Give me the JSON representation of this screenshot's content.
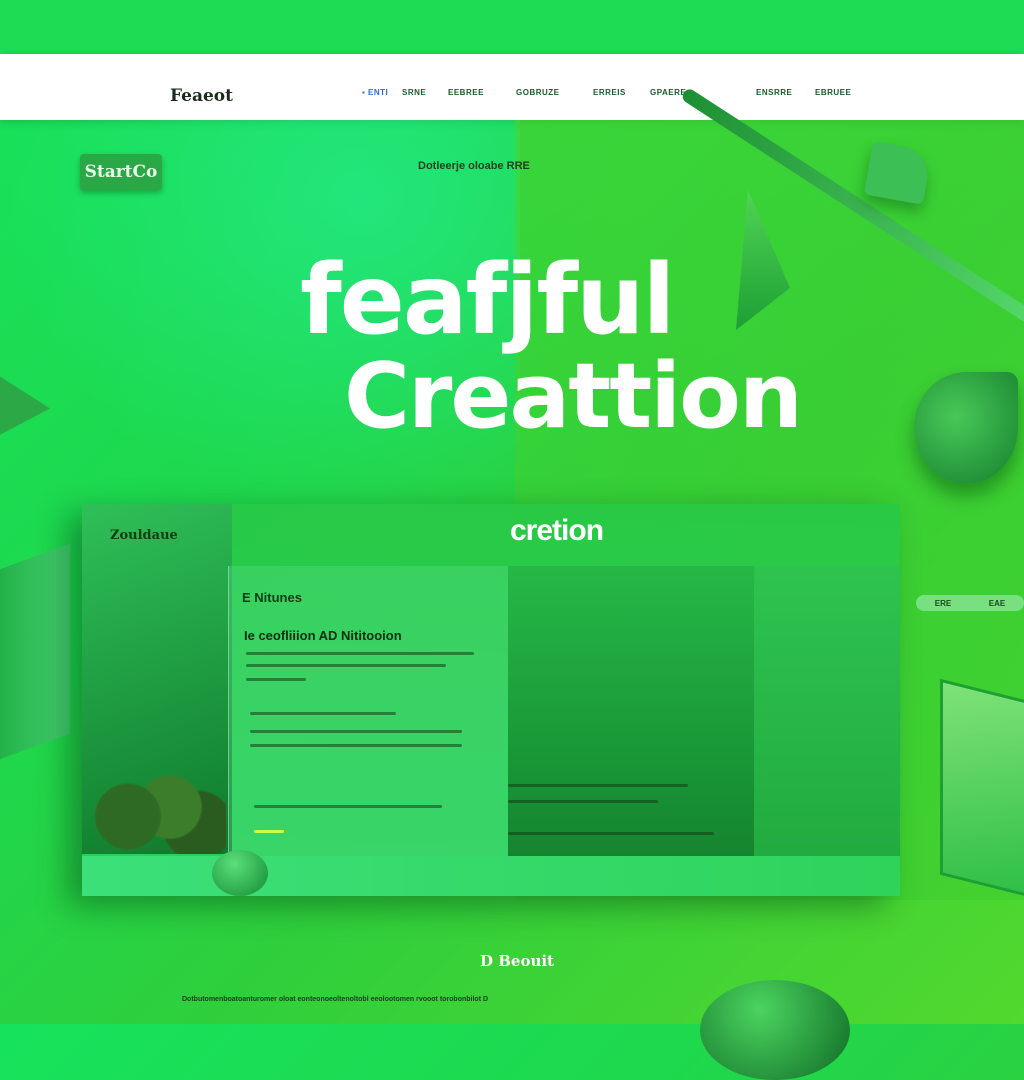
{
  "header": {
    "logo": "Feaeot",
    "nav": [
      "▪ ENTI",
      "SRNE",
      "EEBREE",
      "GOBRUZE",
      "ERREIS",
      "GPAERE",
      "ENSRRE",
      "EBRUEE"
    ]
  },
  "hero": {
    "badge": "StartCo",
    "tagline": "Dotleerje oloabe RRE",
    "title_line1": "feafjful",
    "title_line2": "Creattion"
  },
  "card": {
    "left_label": "Zouldaue",
    "heading": "cretion",
    "subheading": "E Nitunes",
    "title": "Ie ceofliiion AD Nititooion"
  },
  "pill": {
    "left": "ERE",
    "right": "EAE"
  },
  "footer": {
    "logo": "D Beouit",
    "text": "Dotbutomenboatoanturomer oloat eonteonoeoltenoltobl eeolootomen rvooot torobonbilot D"
  },
  "colors": {
    "accent": "#1fdc55",
    "navbar": "#ffffff",
    "dark_green": "#1a9a38"
  }
}
